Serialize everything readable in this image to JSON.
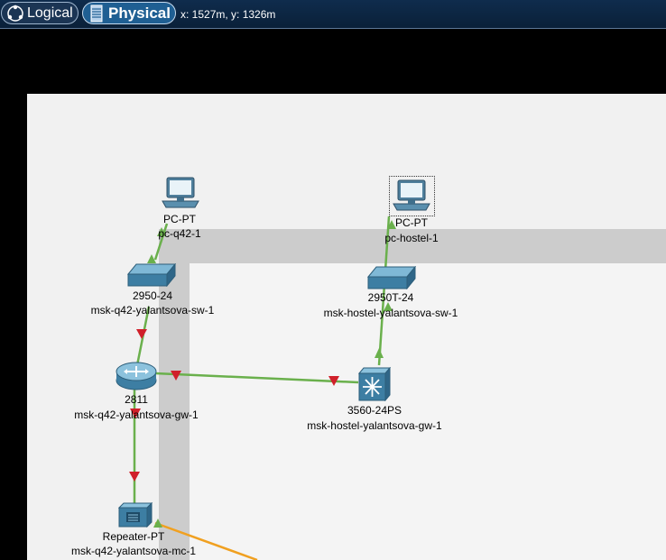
{
  "toolbar": {
    "logical_label": "Logical",
    "physical_label": "Physical",
    "coordinates": "x: 1527m, y: 1326m"
  },
  "devices": {
    "pc_q42": {
      "model": "PC-PT",
      "name": "pc-q42-1",
      "icon": "pc-icon"
    },
    "pc_hostel": {
      "model": "PC-PT",
      "name": "pc-hostel-1",
      "icon": "pc-icon"
    },
    "sw_q42": {
      "model": "2950-24",
      "name": "msk-q42-yalantsova-sw-1",
      "icon": "switch-icon"
    },
    "sw_hostel": {
      "model": "2950T-24",
      "name": "msk-hostel-yalantsova-sw-1",
      "icon": "switch-icon"
    },
    "gw_q42": {
      "model": "2811",
      "name": "msk-q42-yalantsova-gw-1",
      "icon": "router-icon"
    },
    "gw_hostel": {
      "model": "3560-24PS",
      "name": "msk-hostel-yalantsova-gw-1",
      "icon": "multilayer-switch-icon"
    },
    "mc_q42": {
      "model": "Repeater-PT",
      "name": "msk-q42-yalantsova-mc-1",
      "icon": "repeater-icon"
    }
  },
  "colors": {
    "link_up": "#6ab04c",
    "link_down_marker": "#d0202a",
    "fiber_link": "#f0a020",
    "active_mode": "#1f5f93"
  }
}
